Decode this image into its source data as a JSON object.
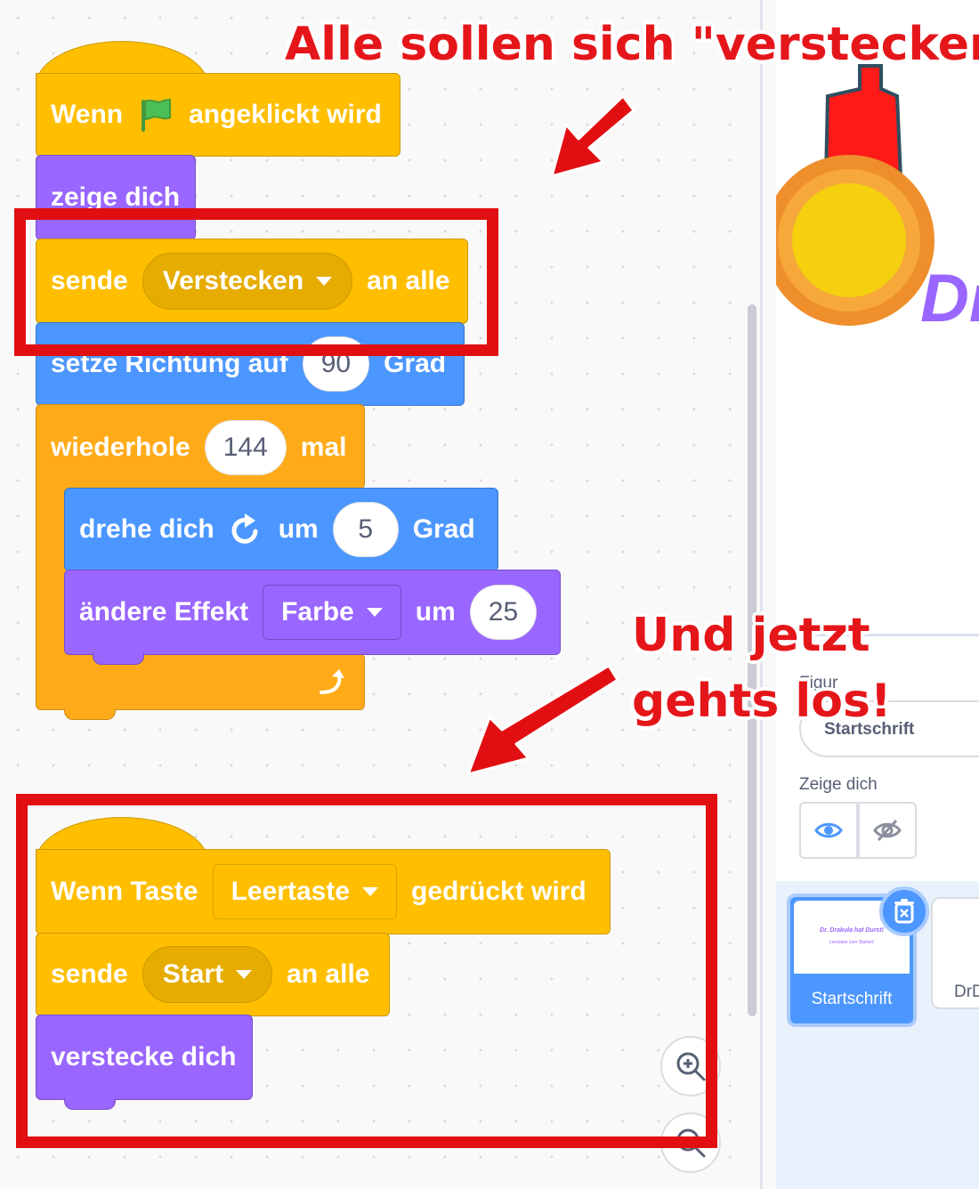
{
  "callouts": {
    "top": "Alle sollen sich \"verstecken\"",
    "bottom_line1": "Und jetzt",
    "bottom_line2": "gehts los!"
  },
  "script1": {
    "hat": {
      "before": "Wenn",
      "after": "angeklickt wird",
      "icon": "green-flag-icon"
    },
    "show": "zeige dich",
    "broadcast": {
      "label": "sende",
      "message": "Verstecken",
      "suffix": "an alle"
    },
    "point": {
      "label": "setze Richtung auf",
      "value": "90",
      "unit": "Grad"
    },
    "repeat": {
      "label": "wiederhole",
      "count": "144",
      "unit": "mal"
    },
    "turn": {
      "label": "drehe dich",
      "mid": "um",
      "value": "5",
      "unit": "Grad",
      "icon": "rotate-clockwise-icon"
    },
    "effect": {
      "label": "ändere Effekt",
      "option": "Farbe",
      "mid": "um",
      "value": "25"
    }
  },
  "script2": {
    "hat": {
      "before": "Wenn Taste",
      "key": "Leertaste",
      "after": "gedrückt wird"
    },
    "broadcast": {
      "label": "sende",
      "message": "Start",
      "suffix": "an alle"
    },
    "hide": "verstecke dich"
  },
  "sprite_info": {
    "section_label": "Figur",
    "sprite_name": "Startschrift",
    "show_label": "Zeige dich"
  },
  "sprite_list": {
    "selected_name": "Startschrift",
    "thumb_text_line1": "Dr. Drakula hat Durst!",
    "thumb_text_line2": "Leertaste zum Starten!",
    "next_name": "DrD"
  },
  "stage": {
    "partial_text": "Dr"
  },
  "colors": {
    "events": "#ffbf00",
    "looks": "#9966ff",
    "motion": "#4c97ff",
    "control": "#ffab19",
    "annotation_red": "#e10f12"
  }
}
